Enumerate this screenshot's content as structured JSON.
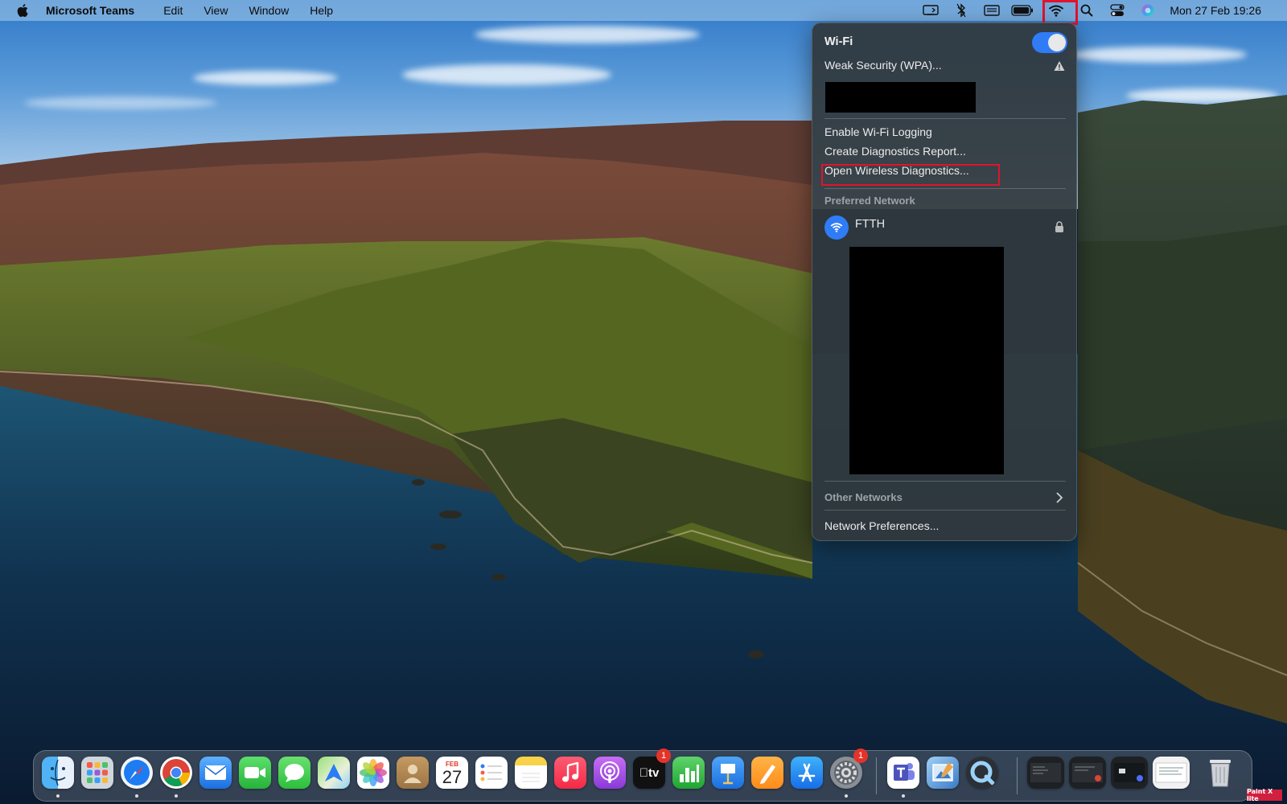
{
  "menubar": {
    "app_name": "Microsoft Teams",
    "menus": [
      "Edit",
      "View",
      "Window",
      "Help"
    ],
    "clock": "Mon 27 Feb  19:26",
    "status_icons": [
      "screen-mirroring-icon",
      "bluetooth-icon",
      "keyboard-input-icon",
      "battery-icon",
      "wifi-icon",
      "search-icon",
      "control-center-icon",
      "siri-icon"
    ]
  },
  "wifi_menu": {
    "title": "Wi-Fi",
    "toggle_on": true,
    "current_network_note": "Weak Security (WPA)...",
    "options": [
      "Enable Wi-Fi Logging",
      "Create Diagnostics Report...",
      "Open Wireless Diagnostics..."
    ],
    "preferred_label": "Preferred Network",
    "preferred_network": "FTTH",
    "other_networks_label": "Other Networks",
    "preferences": "Network Preferences..."
  },
  "dock": {
    "apps": [
      "Finder",
      "Launchpad",
      "Safari",
      "Chrome",
      "Mail",
      "FaceTime",
      "Messages",
      "Maps",
      "Photos",
      "Contacts",
      "Calendar",
      "Reminders",
      "Notes",
      "Music",
      "Podcasts",
      "TV",
      "Numbers",
      "Keynote",
      "Pages",
      "App Store",
      "System Preferences",
      "Microsoft Teams",
      "Preview",
      "QuickTime Player"
    ],
    "calendar": {
      "month": "FEB",
      "day": "27"
    },
    "tv_label": "tv",
    "badges": {
      "tv": "1",
      "system_preferences": "1"
    }
  },
  "watermark": "Paint X lite",
  "colors": {
    "highlight": "#e0142b",
    "accent": "#2f7cf6"
  }
}
